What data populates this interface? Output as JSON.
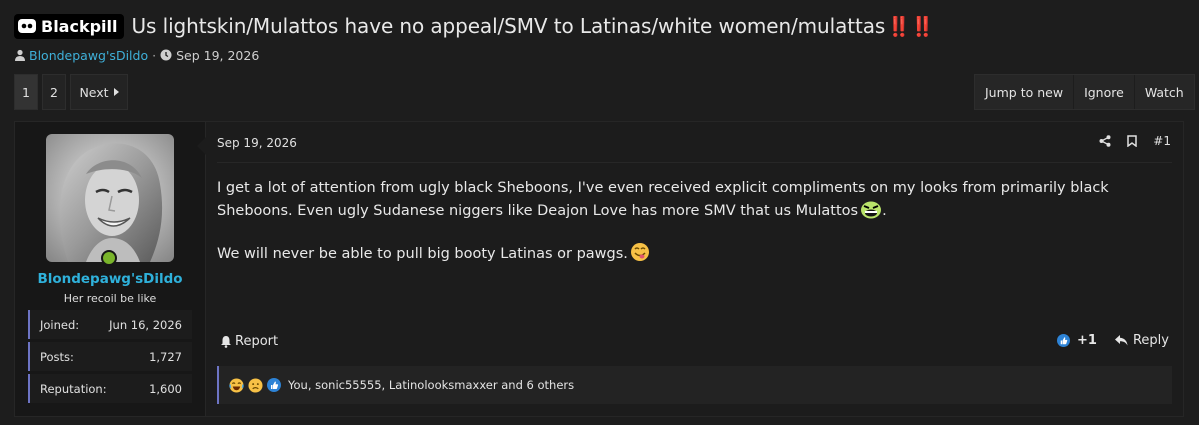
{
  "thread": {
    "prefix": "Blackpill",
    "title": "Us lightskin/Mulattos have no appeal/SMV to Latinas/white women/mulattas",
    "title_suffix": "‼️‼️",
    "author": "Blondepawg'sDildo",
    "date": "Sep 19, 2026"
  },
  "pagination": {
    "pages": [
      "1",
      "2"
    ],
    "current": "1",
    "next_label": "Next"
  },
  "thread_actions": [
    "Jump to new",
    "Ignore",
    "Watch"
  ],
  "post": {
    "user": {
      "name": "Blondepawg'sDildo",
      "title": "Her recoil be like",
      "online": true,
      "stats": [
        {
          "label": "Joined:",
          "value": "Jun 16, 2026"
        },
        {
          "label": "Posts:",
          "value": "1,727"
        },
        {
          "label": "Reputation:",
          "value": "1,600"
        }
      ]
    },
    "date": "Sep 19, 2026",
    "number": "#1",
    "body": [
      "I get a lot of attention from ugly black Sheboons, I've even received explicit compliments on my looks from primarily black Sheboons. Even ugly Sudanese niggers like Deajon Love has more SMV that us Mulattos",
      "We will never be able to pull big booty Latinas or pawgs."
    ],
    "body_suffix": [
      ".",
      ""
    ],
    "report_label": "Report",
    "reaction_count": "+1",
    "reply_label": "Reply",
    "reactions_text": "You, sonic55555, Latinolooksmaxxer and 6 others"
  },
  "colors": {
    "accent_link": "#2fb1db",
    "online": "#7ab52b",
    "stat_border": "#6d74c4",
    "title_exclaim": "#d3223a",
    "like": "#2d83d6"
  },
  "icons": [
    "reddit-like-logo-icon",
    "user-icon",
    "clock-icon",
    "chevron-right-icon",
    "share-icon",
    "bookmark-icon",
    "bell-icon",
    "like-icon",
    "reply-icon",
    "laugh-emoji-icon",
    "sad-emoji-icon"
  ]
}
